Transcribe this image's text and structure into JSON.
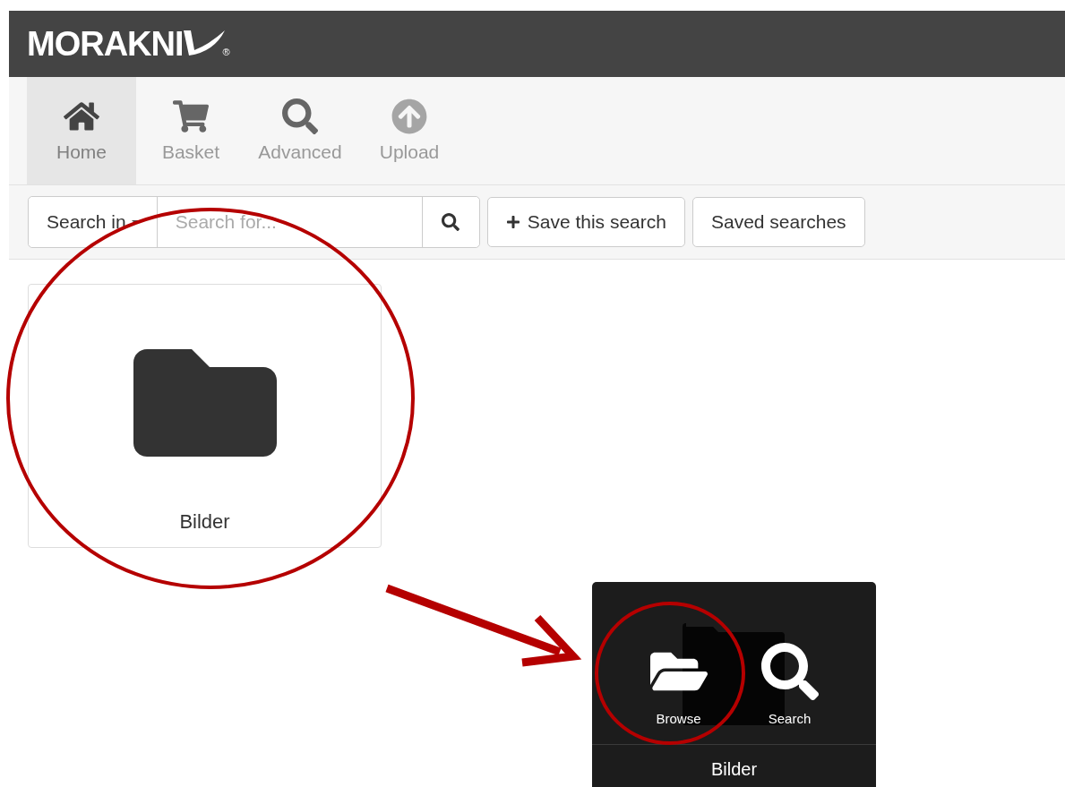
{
  "logo": {
    "text": "MORAKNI",
    "mark": "®"
  },
  "nav": [
    {
      "label": "Home",
      "selected": true,
      "disabled": false
    },
    {
      "label": "Basket",
      "selected": false,
      "disabled": false
    },
    {
      "label": "Advanced",
      "selected": false,
      "disabled": false
    },
    {
      "label": "Upload",
      "selected": false,
      "disabled": true
    }
  ],
  "toolbar": {
    "scope": "Search in",
    "search": {
      "placeholder": "Search for..."
    },
    "save_button": "Save this search",
    "saved_button": "Saved searches"
  },
  "folders": [
    {
      "name": "Bilder"
    }
  ],
  "hover_card": {
    "actions": [
      {
        "label": "Browse"
      },
      {
        "label": "Search"
      }
    ],
    "name": "Bilder"
  }
}
